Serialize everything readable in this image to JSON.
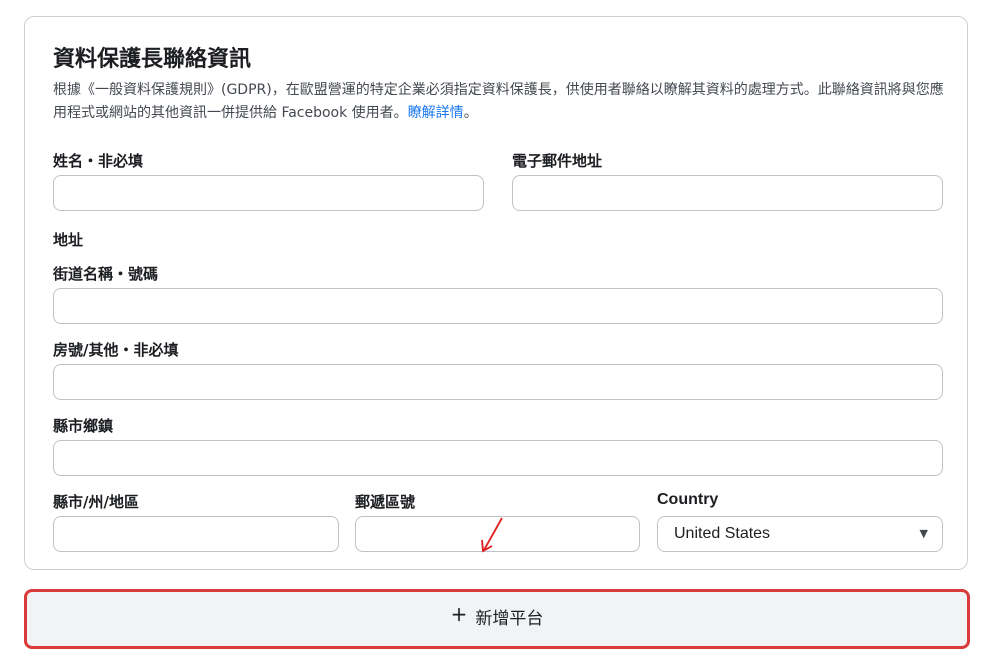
{
  "section": {
    "title": "資料保護長聯絡資訊",
    "description": "根據《一般資料保護規則》(GDPR)，在歐盟營運的特定企業必須指定資料保護長，供使用者聯絡以瞭解其資料的處理方式。此聯絡資訊將與您應用程式或網站的其他資訊一併提供給 Facebook 使用者。",
    "learn_more": "瞭解詳情",
    "learn_more_suffix": "。"
  },
  "form": {
    "name_label": "姓名・非必填",
    "name_value": "",
    "email_label": "電子郵件地址",
    "email_value": "",
    "address_heading": "地址",
    "street_label": "街道名稱・號碼",
    "street_value": "",
    "unit_label": "房號/其他・非必填",
    "unit_value": "",
    "town_label": "縣市鄉鎮",
    "town_value": "",
    "state_label": "縣市/州/地區",
    "state_value": "",
    "zip_label": "郵遞區號",
    "zip_value": "",
    "country_label": "Country",
    "country_selected": "United States"
  },
  "actions": {
    "add_platform_label": "新增平台",
    "add_platform_icon": "plus-icon"
  },
  "colors": {
    "link": "#1877f2",
    "highlight_border": "#d93a3a",
    "annotation_arrow": "#e02020"
  }
}
